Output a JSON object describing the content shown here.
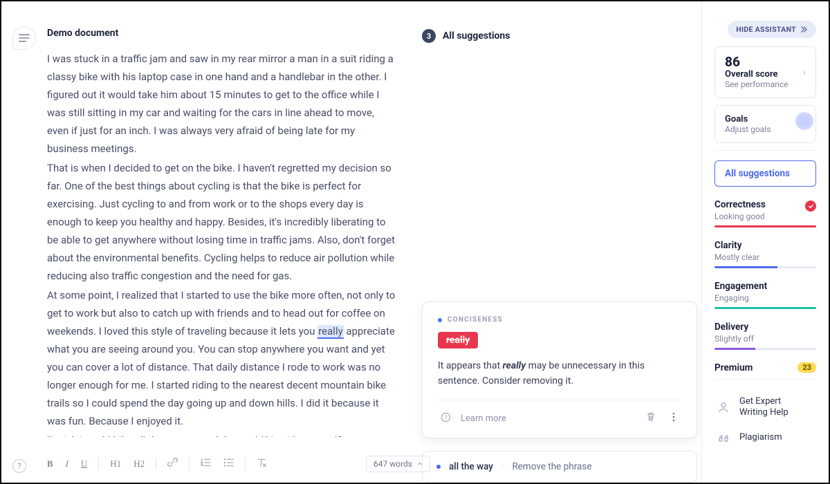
{
  "header": {
    "doc_title": "Demo document",
    "all_suggestions_label": "All suggestions",
    "all_suggestions_count": "3",
    "hide_assistant_label": "HIDE ASSISTANT"
  },
  "document": {
    "p1": "I was stuck in a traffic jam and saw in my rear mirror a man in a suit riding a classy bike with his laptop case in one hand and a handlebar in the other. I figured out it would take him about 15 minutes to get to the office while I was still sitting in my car and waiting for the cars in line ahead to move, even if just for an inch. I was always very afraid of being late for my business meetings.",
    "p2": "That is when I decided to get on the bike. I haven't regretted my decision so far. One of the best things about cycling is that the bike is perfect for exercising. Just cycling to and from work or to the shops every day is enough to keep you healthy and happy. Besides, it's incredibly liberating to be able to get anywhere without losing time in traffic jams. Also, don't forget about the environmental benefits. Cycling helps to reduce air pollution while reducing also traffic congestion and the need for gas.",
    "p3a": "At some point, I realized that I started to use the bike more often, not only to get to work but also to catch up with friends and to head out for coffee on weekends. I loved this style of traveling because it lets you ",
    "highlight": "really",
    "p3b": " appreciate what you are seeing around you. You can stop anywhere you want and yet you can cover a lot of distance. That daily distance I rode to work was no longer enough for me. I started riding to the nearest decent mountain bike trails so I could spend the day going up and down hills. I did it because it was fun. Because I enjoyed it.",
    "p4": "\"I wish I could bike all the way around the world,\" I said to myself one"
  },
  "card": {
    "category": "CONCISENESS",
    "chip": "really",
    "msg_pre": "It appears that ",
    "msg_bold": "really",
    "msg_post": " may be unnecessary in this sentence. Consider removing it.",
    "learn_more": "Learn more"
  },
  "mini": {
    "term": "all the way",
    "action": "Remove the phrase"
  },
  "sidebar": {
    "score_value": "86",
    "score_label": "Overall score",
    "score_link": "See performance",
    "goals_title": "Goals",
    "goals_link": "Adjust goals",
    "tab_label": "All suggestions",
    "metrics": {
      "correctness": {
        "name": "Correctness",
        "sub": "Looking good",
        "color": "#e8364f"
      },
      "clarity": {
        "name": "Clarity",
        "sub": "Mostly clear",
        "color": "#4f6bed"
      },
      "engagement": {
        "name": "Engagement",
        "sub": "Engaging",
        "color": "#19c3a3"
      },
      "delivery": {
        "name": "Delivery",
        "sub": "Slightly off",
        "color": "#8a5bd6"
      },
      "premium": {
        "name": "Premium",
        "badge": "23"
      }
    },
    "help": {
      "expert": "Get Expert Writing Help",
      "plagiarism": "Plagiarism"
    }
  },
  "toolbar": {
    "wordcount": "647 words",
    "h1": "H1",
    "h2": "H2"
  }
}
